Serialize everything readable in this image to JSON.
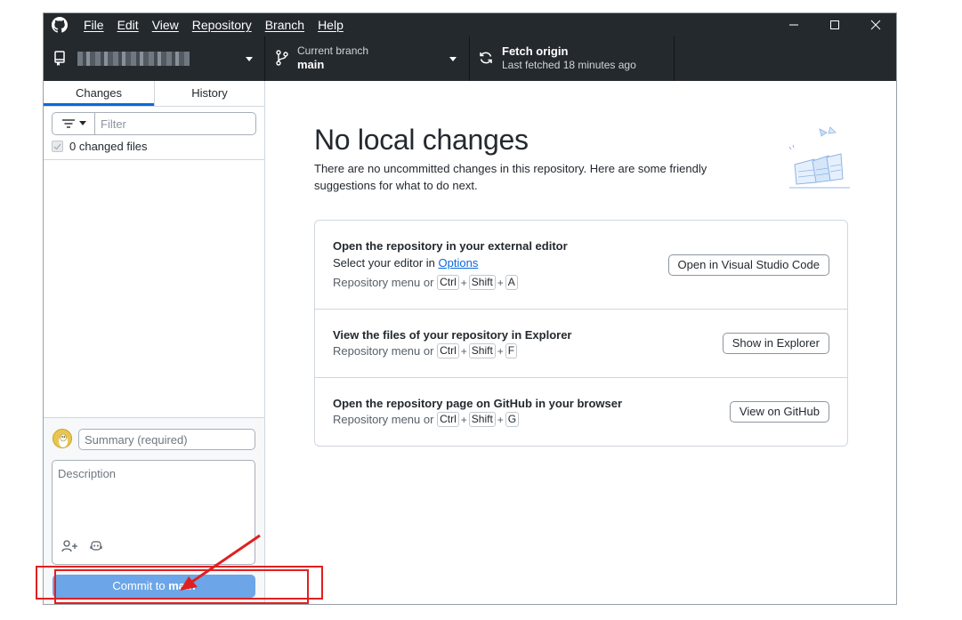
{
  "menu": [
    "File",
    "Edit",
    "View",
    "Repository",
    "Branch",
    "Help"
  ],
  "toolbar": {
    "branch_label": "Current branch",
    "branch_name": "main",
    "fetch_title": "Fetch origin",
    "fetch_subtitle": "Last fetched 18 minutes ago"
  },
  "sidebar": {
    "tabs": [
      "Changes",
      "History"
    ],
    "filter_placeholder": "Filter",
    "changed_files": "0 changed files"
  },
  "commit": {
    "summary_placeholder": "Summary (required)",
    "description_placeholder": "Description",
    "button_prefix": "Commit to ",
    "button_branch": "main"
  },
  "main": {
    "title": "No local changes",
    "description": "There are no uncommitted changes in this repository. Here are some friendly suggestions for what to do next.",
    "cards": [
      {
        "title": "Open the repository in your external editor",
        "line_prefix": "Select your editor in ",
        "line_link": "Options",
        "hint_prefix": "Repository menu or",
        "keys": [
          "Ctrl",
          "Shift",
          "A"
        ],
        "button": "Open in Visual Studio Code"
      },
      {
        "title": "View the files of your repository in Explorer",
        "hint_prefix": "Repository menu or",
        "keys": [
          "Ctrl",
          "Shift",
          "F"
        ],
        "button": "Show in Explorer"
      },
      {
        "title": "Open the repository page on GitHub in your browser",
        "hint_prefix": "Repository menu or",
        "keys": [
          "Ctrl",
          "Shift",
          "G"
        ],
        "button": "View on GitHub"
      }
    ]
  },
  "colors": {
    "titlebar": "#24292e",
    "accent": "#0969da",
    "commit_button": "#6ca6e8",
    "annotation": "#e02020"
  }
}
